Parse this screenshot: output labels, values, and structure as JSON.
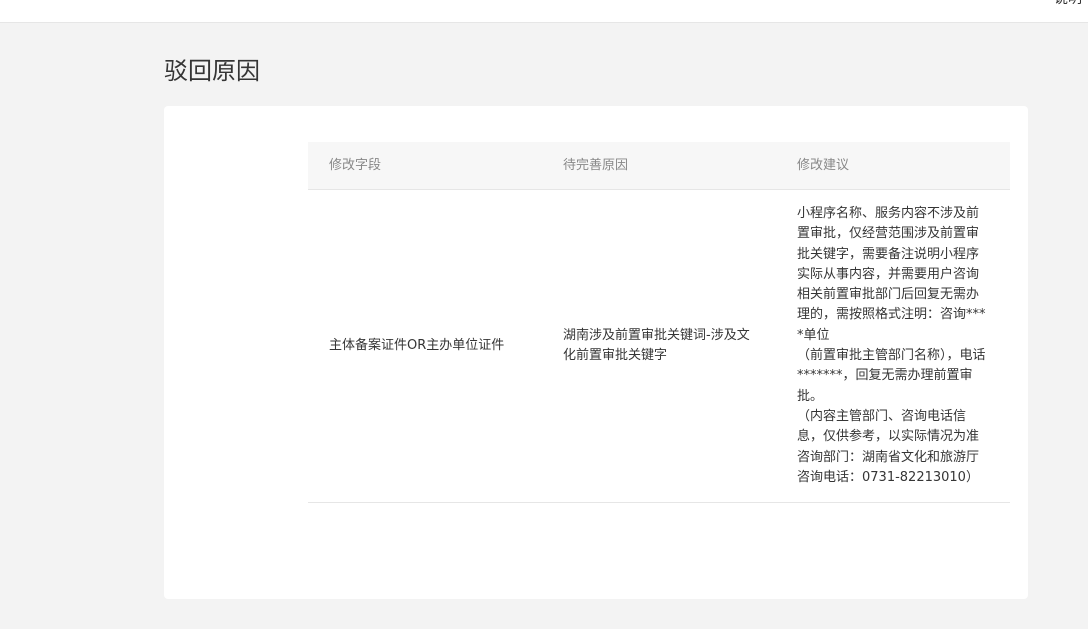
{
  "top_bar": {
    "corner_glyph": "说明"
  },
  "page": {
    "title": "驳回原因"
  },
  "table": {
    "headers": [
      "修改字段",
      "待完善原因",
      "修改建议"
    ],
    "rows": [
      {
        "field": "主体备案证件OR主办单位证件",
        "reason": "湖南涉及前置审批关键词-涉及文化前置审批关键字",
        "suggestion": "小程序名称、服务内容不涉及前置审批，仅经营范围涉及前置审批关键字，需要备注说明小程序实际从事内容，并需要用户咨询相关前置审批部门后回复无需办理的，需按照格式注明：咨询****单位\n（前置审批主管部门名称），电话*******，回复无需办理前置审批。\n（内容主管部门、咨询电话信息，仅供参考，以实际情况为准\n咨询部门：湖南省文化和旅游厅　咨询电话：0731-82213010）"
      }
    ]
  }
}
